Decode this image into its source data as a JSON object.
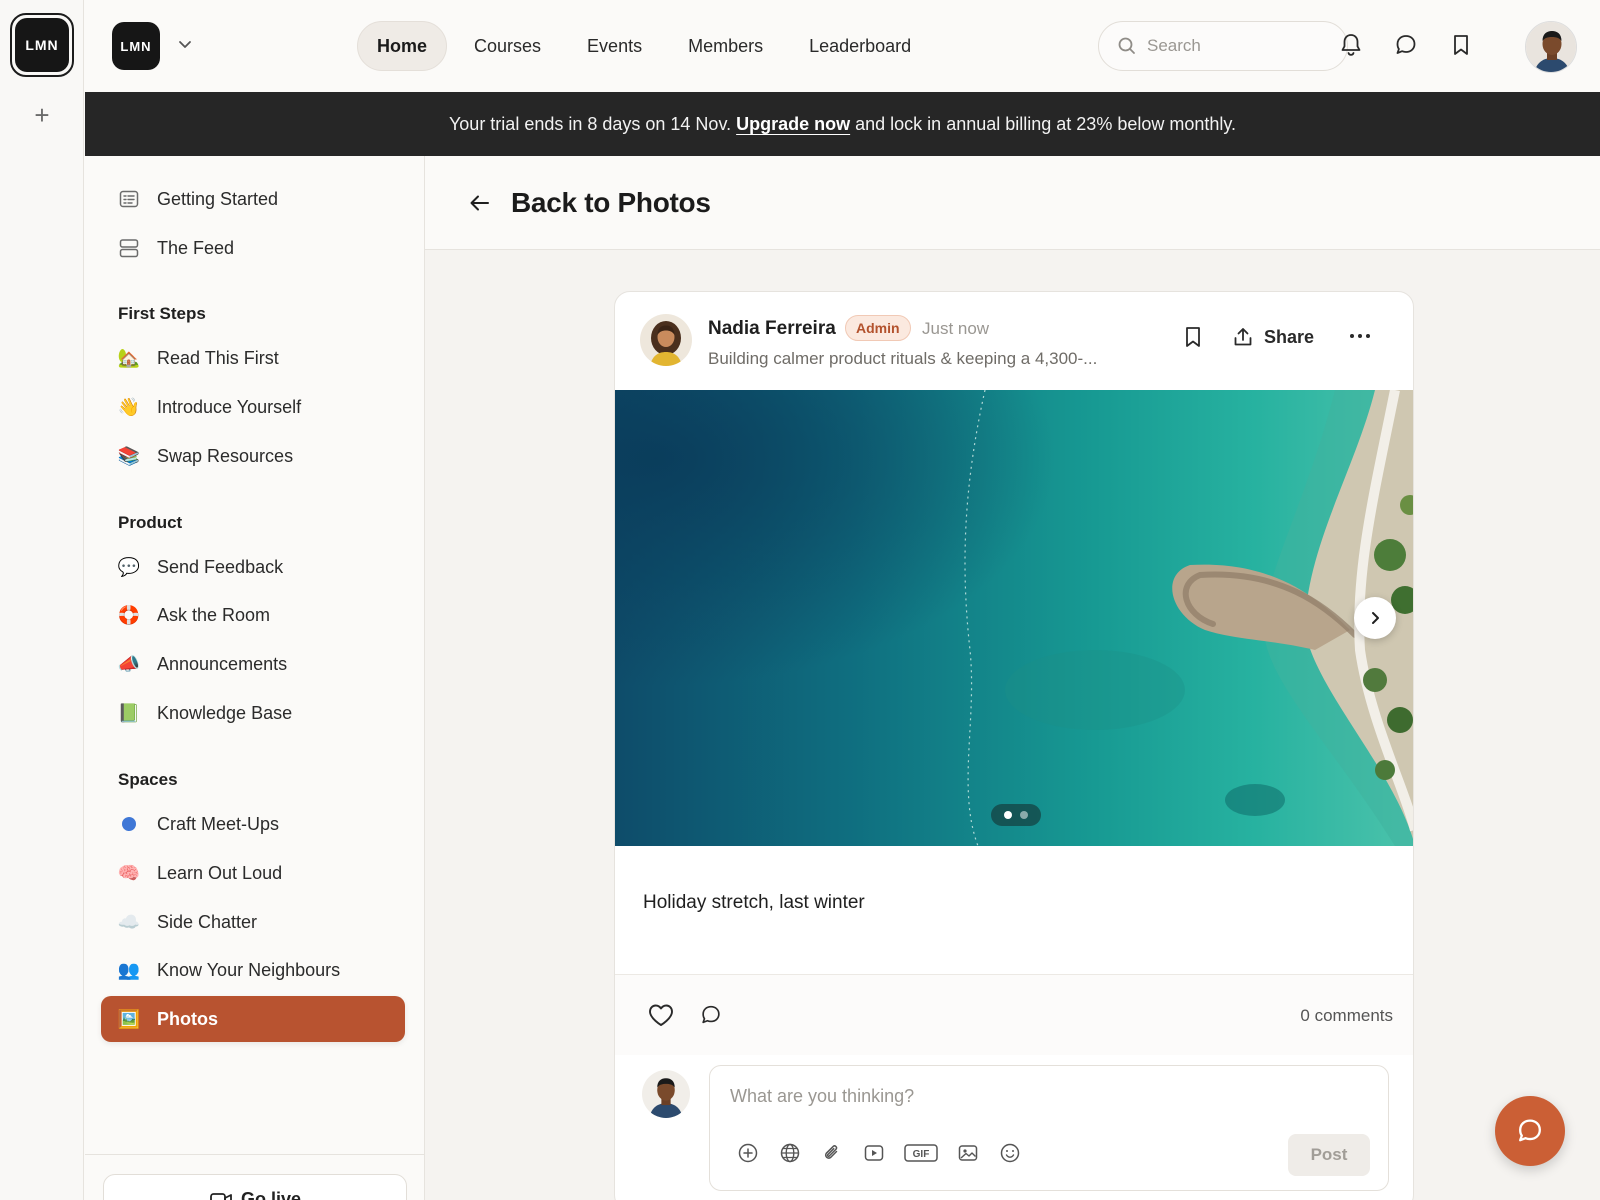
{
  "rail": {
    "logo_text": "LMN",
    "add_label": "+"
  },
  "header": {
    "brand_text": "LMN",
    "nav": [
      {
        "label": "Home",
        "active": true
      },
      {
        "label": "Courses",
        "active": false
      },
      {
        "label": "Events",
        "active": false
      },
      {
        "label": "Members",
        "active": false
      },
      {
        "label": "Leaderboard",
        "active": false
      }
    ],
    "search_placeholder": "Search",
    "icons": [
      "bell-icon",
      "chat-bubble-icon",
      "bookmark-icon"
    ]
  },
  "banner": {
    "text_before": "Your trial ends in 8 days on 14 Nov.",
    "link": "Upgrade now",
    "text_after": "and lock in annual billing at 23% below monthly."
  },
  "sidebar": {
    "top_items": [
      {
        "label": "Getting Started",
        "icon": "checklist-icon"
      },
      {
        "label": "The Feed",
        "icon": "feed-icon"
      }
    ],
    "sections": [
      {
        "title": "First Steps",
        "items": [
          {
            "label": "Read This First",
            "emoji": "🏡"
          },
          {
            "label": "Introduce Yourself",
            "emoji": "👋"
          },
          {
            "label": "Swap Resources",
            "emoji": "📚"
          }
        ]
      },
      {
        "title": "Product",
        "items": [
          {
            "label": "Send Feedback",
            "emoji": "💬"
          },
          {
            "label": "Ask the Room",
            "emoji": "🛟"
          },
          {
            "label": "Announcements",
            "emoji": "📣"
          },
          {
            "label": "Knowledge Base",
            "emoji": "📗"
          }
        ]
      },
      {
        "title": "Spaces",
        "items": [
          {
            "label": "Craft Meet-Ups",
            "emoji": "🔵"
          },
          {
            "label": "Learn Out Loud",
            "emoji": "🧠"
          },
          {
            "label": "Side Chatter",
            "emoji": "☁️"
          },
          {
            "label": "Know Your Neighbours",
            "emoji": "👥"
          },
          {
            "label": "Photos",
            "emoji": "🖼️",
            "active": true
          }
        ]
      }
    ],
    "go_live_label": "Go live"
  },
  "main": {
    "back_label": "Back to Photos",
    "post": {
      "author": "Nadia Ferreira",
      "role_badge": "Admin",
      "time": "Just now",
      "tagline": "Building calmer product rituals & keeping a 4,300-...",
      "share_label": "Share",
      "caption": "Holiday stretch, last winter",
      "comments_count": "0 comments",
      "carousel": {
        "current": 1,
        "total": 2
      }
    },
    "composer": {
      "placeholder": "What are you thinking?",
      "post_label": "Post",
      "gif_label": "GIF"
    }
  },
  "colors": {
    "accent": "#b85330",
    "banner_bg": "#262626",
    "fab": "#cb5f35"
  }
}
